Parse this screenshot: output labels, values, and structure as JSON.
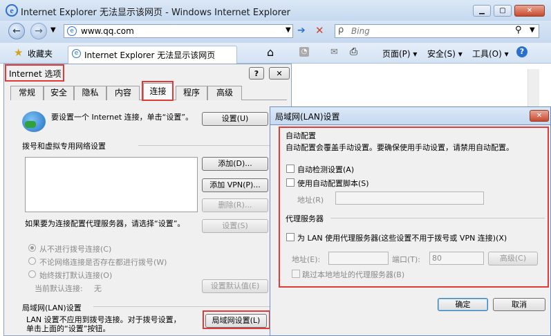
{
  "browser": {
    "window_title": "Internet Explorer 无法显示该网页 - Windows Internet Explorer",
    "address": "www.qq.com",
    "search_placeholder": "Bing",
    "favorites_label": "收藏夹",
    "tab_title": "Internet Explorer 无法显示该网页",
    "menu": {
      "page": "页面(P)",
      "safety": "安全(S)",
      "tools": "工具(O)"
    }
  },
  "internet_options": {
    "title": "Internet 选项",
    "help_btn": "?",
    "tabs": [
      "常规",
      "安全",
      "隐私",
      "内容",
      "连接",
      "程序",
      "高级"
    ],
    "active_tab": "连接",
    "setup_text": "要设置一个 Internet 连接，单击“设置”。",
    "setup_btn": "设置(U)",
    "dialup_header": "拨号和虚拟专用网络设置",
    "add_btn": "添加(D)...",
    "add_vpn_btn": "添加 VPN(P)...",
    "remove_btn": "删除(R)...",
    "proxy_hint": "如果要为连接配置代理服务器，请选择“设置”。",
    "settings_btn": "设置(S)",
    "radios": [
      "从不进行拨号连接(C)",
      "不论网络连接是否存在都进行拨号(W)",
      "始终拨打默认连接(O)"
    ],
    "current_default_label": "当前默认连接:",
    "current_default_value": "无",
    "set_default_btn": "设置默认值(E)",
    "lan_header": "局域网(LAN)设置",
    "lan_hint": "LAN 设置不应用到拨号连接。对于拨号设置，单击上面的“设置”按钮。",
    "lan_btn": "局域网设置(L)"
  },
  "lan_dialog": {
    "title": "局域网(LAN)设置",
    "auto_config_header": "自动配置",
    "auto_config_desc": "自动配置会覆盖手动设置。要确保使用手动设置，请禁用自动配置。",
    "auto_detect": "自动检测设置(A)",
    "use_script": "使用自动配置脚本(S)",
    "address_label": "地址(R)",
    "proxy_header": "代理服务器",
    "use_proxy": "为 LAN 使用代理服务器(这些设置不用于拨号或 VPN 连接)(X)",
    "proxy_addr_label": "地址(E):",
    "port_label": "端口(T):",
    "port_value": "80",
    "advanced_btn": "高级(C)",
    "bypass_local": "跳过本地地址的代理服务器(B)",
    "ok_btn": "确定",
    "cancel_btn": "取消"
  },
  "colors": {
    "highlight": "#e03a3a",
    "chrome": "#c6d9ef"
  }
}
